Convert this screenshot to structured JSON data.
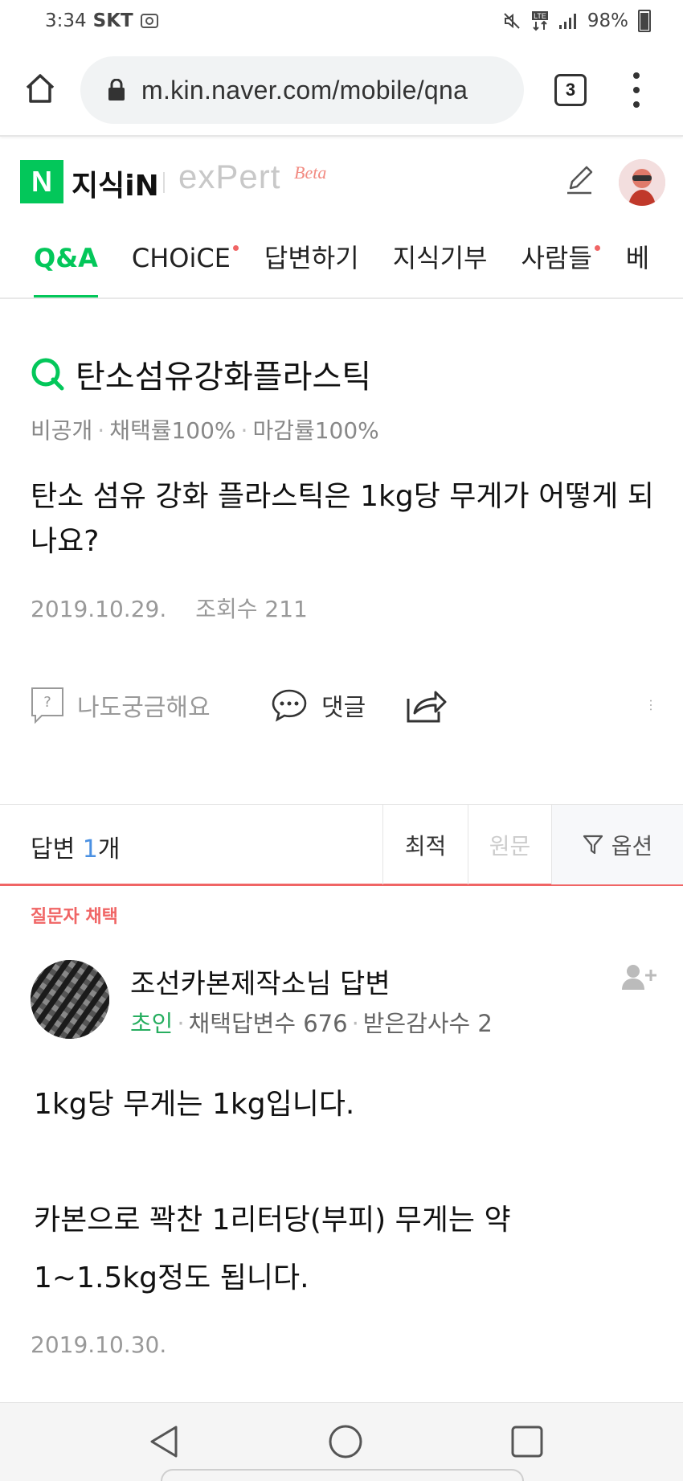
{
  "status_bar": {
    "time": "3:34",
    "carrier": "SKT",
    "battery": "98%"
  },
  "browser": {
    "url": "m.kin.naver.com/mobile/qna",
    "tab_count": "3"
  },
  "header": {
    "logo_mark": "N",
    "logo_text": "지식iN",
    "expert_text": "exPert",
    "beta_text": "Beta"
  },
  "nav": {
    "tabs": [
      {
        "label": "Q&A",
        "active": true
      },
      {
        "label": "CHOiCE",
        "dot": true
      },
      {
        "label": "답변하기"
      },
      {
        "label": "지식기부"
      },
      {
        "label": "사람들",
        "dot": true
      },
      {
        "label": "베"
      }
    ]
  },
  "question": {
    "title": "탄소섬유강화플라스틱",
    "meta": [
      "비공개",
      "채택률100%",
      "마감률100%"
    ],
    "body": "탄소 섬유 강화 플라스틱은 1kg당 무게가 어떻게 되나요?",
    "date": "2019.10.29.",
    "views": "조회수 211",
    "actions": {
      "curious": "나도궁금해요",
      "comment": "댓글"
    }
  },
  "answers_bar": {
    "label_prefix": "답변 ",
    "count": "1",
    "label_suffix": "개",
    "sort_latest": "최적",
    "sort_original": "원문",
    "options": "옵션"
  },
  "answer": {
    "choice_label": "질문자 채택",
    "author": "조선카본제작소님 답변",
    "grade": "초인",
    "stats": [
      "채택답변수 676",
      "받은감사수 2"
    ],
    "body": "1kg당 무게는 1kg입니다.\n\n카본으로 꽉찬 1리터당(부피) 무게는 약\n1~1.5kg정도 됩니다.",
    "date": "2019.10.30."
  },
  "colors": {
    "naver_green": "#03c75a",
    "accent_red": "#f06565",
    "link_blue": "#4a90e2",
    "grade_green": "#27ae60"
  }
}
